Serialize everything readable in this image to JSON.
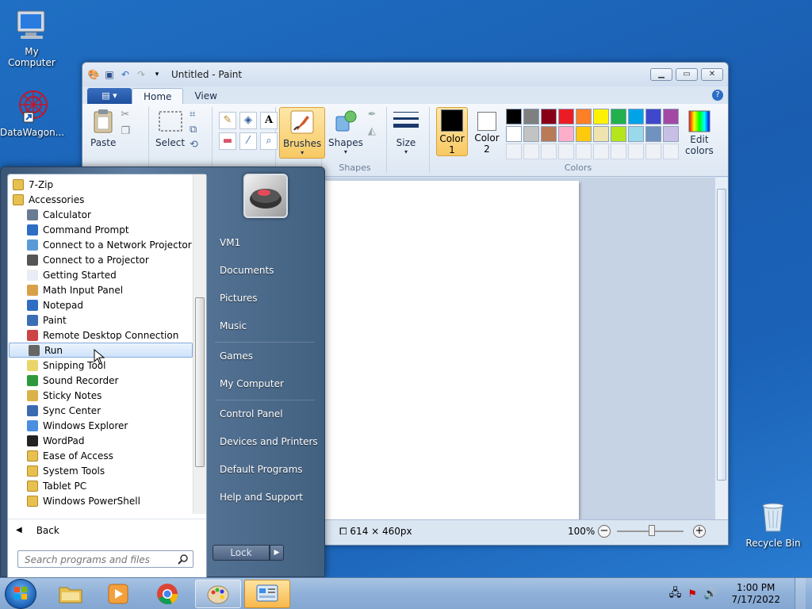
{
  "desktop": {
    "icons": [
      {
        "label": "My Computer"
      },
      {
        "label": "DataWagon..."
      },
      {
        "label": "Recycle Bin"
      }
    ]
  },
  "paint": {
    "title": "Untitled - Paint",
    "tabs": {
      "home": "Home",
      "view": "View"
    },
    "ribbon": {
      "paste": "Paste",
      "select": "Select",
      "brushes": "Brushes",
      "shapes": "Shapes",
      "size": "Size",
      "color1_line1": "Color",
      "color1_line2": "1",
      "color2_line1": "Color",
      "color2_line2": "2",
      "edit_colors_line1": "Edit",
      "edit_colors_line2": "colors",
      "group_shapes": "Shapes",
      "group_colors": "Colors"
    },
    "palette": [
      "#000000",
      "#7f7f7f",
      "#880015",
      "#ed1c24",
      "#ff7f27",
      "#fff200",
      "#22b14c",
      "#00a2e8",
      "#3f48cc",
      "#a349a4",
      "#ffffff",
      "#c3c3c3",
      "#b97a57",
      "#ffaec9",
      "#ffc90e",
      "#efe4b0",
      "#b5e61d",
      "#99d9ea",
      "#7092be",
      "#c8bfe7"
    ],
    "color1": "#000000",
    "color2": "#ffffff",
    "status": {
      "dimensions": "614 × 460px",
      "zoom": "100%"
    }
  },
  "start_menu": {
    "programs": [
      {
        "label": "7-Zip",
        "folder": true
      },
      {
        "label": "Accessories",
        "folder": true
      },
      {
        "label": "Calculator"
      },
      {
        "label": "Command Prompt"
      },
      {
        "label": "Connect to a Network Projector"
      },
      {
        "label": "Connect to a Projector"
      },
      {
        "label": "Getting Started"
      },
      {
        "label": "Math Input Panel"
      },
      {
        "label": "Notepad"
      },
      {
        "label": "Paint"
      },
      {
        "label": "Remote Desktop Connection"
      },
      {
        "label": "Run"
      },
      {
        "label": "Snipping Tool"
      },
      {
        "label": "Sound Recorder"
      },
      {
        "label": "Sticky Notes"
      },
      {
        "label": "Sync Center"
      },
      {
        "label": "Windows Explorer"
      },
      {
        "label": "WordPad"
      },
      {
        "label": "Ease of Access",
        "folder": true
      },
      {
        "label": "System Tools",
        "folder": true
      },
      {
        "label": "Tablet PC",
        "folder": true
      },
      {
        "label": "Windows PowerShell",
        "folder": true
      }
    ],
    "back": "Back",
    "search_placeholder": "Search programs and files",
    "right": {
      "user": "VM1",
      "documents": "Documents",
      "pictures": "Pictures",
      "music": "Music",
      "games": "Games",
      "computer": "My Computer",
      "control_panel": "Control Panel",
      "devices": "Devices and Printers",
      "defaults": "Default Programs",
      "help": "Help and Support"
    },
    "lock": "Lock"
  },
  "taskbar": {
    "time": "1:00 PM",
    "date": "7/17/2022"
  }
}
